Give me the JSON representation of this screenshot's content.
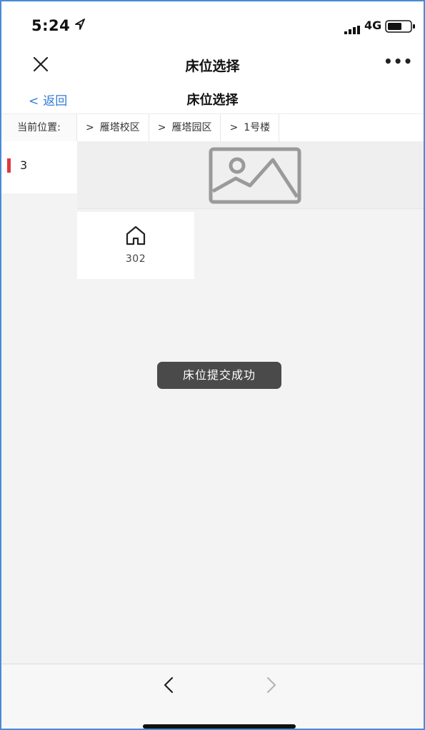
{
  "status_bar": {
    "time": "5:24",
    "network": "4G"
  },
  "nav_bar": {
    "title": "床位选择",
    "more": "•••"
  },
  "sub_header": {
    "back_label": "返回",
    "back_chevron": "<",
    "title": "床位选择"
  },
  "breadcrumb": {
    "label": "当前位置:",
    "items": [
      {
        "sep": ">",
        "label": "雁塔校区"
      },
      {
        "sep": ">",
        "label": "雁塔园区"
      },
      {
        "sep": ">",
        "label": "1号楼"
      }
    ]
  },
  "floors": [
    {
      "label": "3",
      "selected": true
    }
  ],
  "rooms": [
    {
      "number": "302"
    }
  ],
  "toast": {
    "message": "床位提交成功"
  },
  "bottom_bar": {
    "back": "<",
    "forward": ">"
  },
  "colors": {
    "accent": "#2f7bd9",
    "selected_marker": "#e0383e",
    "toast_bg": "#4a4a4a"
  },
  "icons": [
    "location-arrow-icon",
    "signal-icon",
    "battery-icon",
    "close-icon",
    "more-icon",
    "image-placeholder-icon",
    "home-icon"
  ]
}
